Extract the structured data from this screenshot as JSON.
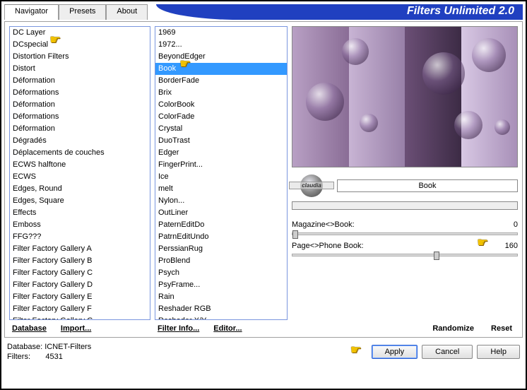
{
  "title": "Filters Unlimited 2.0",
  "tabs": [
    "Navigator",
    "Presets",
    "About"
  ],
  "active_tab": 0,
  "categories": {
    "items": [
      "DC Layer",
      "DCspecial",
      "Distortion Filters",
      "Distort",
      "Déformation",
      "Déformations",
      "Déformation",
      "Déformations",
      "Déformation",
      "Dégradés",
      "Déplacements de couches",
      "ECWS halftone",
      "ECWS",
      "Edges, Round",
      "Edges, Square",
      "Effects",
      "Emboss",
      "FFG???",
      "Filter Factory Gallery A",
      "Filter Factory Gallery B",
      "Filter Factory Gallery C",
      "Filter Factory Gallery D",
      "Filter Factory Gallery E",
      "Filter Factory Gallery F",
      "Filter Factory Gallery G"
    ],
    "selected_index": -1,
    "pointer_index": 1
  },
  "filters": {
    "items": [
      "1969",
      "1972...",
      "BeyondEdger",
      "Book",
      "BorderFade",
      "Brix",
      "ColorBook",
      "ColorFade",
      "Crystal",
      "DuoTrast",
      "Edger",
      "FingerPrint...",
      "Ice",
      "melt",
      "Nylon...",
      "OutLiner",
      "PaternEditDo",
      "PatrnEditUndo",
      "PerssianRug",
      "ProBlend",
      "Psych",
      "PsyFrame...",
      "Rain",
      "Reshader RGB",
      "Reshader X/Y"
    ],
    "selected_index": 3,
    "pointer_index": 3
  },
  "cat_links": {
    "database": "Database",
    "import": "Import..."
  },
  "filter_links": {
    "info": "Filter Info...",
    "editor": "Editor..."
  },
  "current_filter_name": "Book",
  "watermark": "claudia",
  "params": [
    {
      "label": "Magazine<>Book:",
      "value": 0,
      "max": 255
    },
    {
      "label": "Page<>Phone Book:",
      "value": 160,
      "max": 255
    }
  ],
  "param_pointer_index": 1,
  "right_links": {
    "randomize": "Randomize",
    "reset": "Reset"
  },
  "footer": {
    "db_label": "Database:",
    "db_value": "ICNET-Filters",
    "filters_label": "Filters:",
    "filters_value": "4531"
  },
  "buttons": {
    "apply": "Apply",
    "cancel": "Cancel",
    "help": "Help"
  }
}
